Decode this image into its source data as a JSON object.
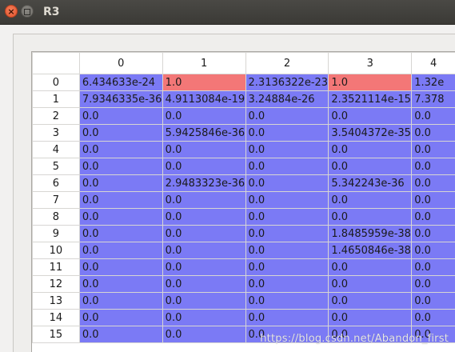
{
  "window": {
    "title": "R3"
  },
  "table": {
    "columns": [
      "0",
      "1",
      "2",
      "3",
      "4"
    ],
    "rows": [
      {
        "label": "0",
        "cells": [
          "6.434633e-24",
          "1.0",
          "2.3136322e-23",
          "1.0",
          "1.32e"
        ],
        "highlight": [
          false,
          true,
          false,
          true,
          false
        ]
      },
      {
        "label": "1",
        "cells": [
          "7.9346335e-36",
          "4.9113084e-19",
          "3.24884e-26",
          "2.3521114e-15",
          "7.378"
        ],
        "highlight": [
          false,
          false,
          false,
          false,
          false
        ]
      },
      {
        "label": "2",
        "cells": [
          "0.0",
          "0.0",
          "0.0",
          "0.0",
          "0.0"
        ],
        "highlight": [
          false,
          false,
          false,
          false,
          false
        ]
      },
      {
        "label": "3",
        "cells": [
          "0.0",
          "5.9425846e-36",
          "0.0",
          "3.5404372e-35",
          "0.0"
        ],
        "highlight": [
          false,
          false,
          false,
          false,
          false
        ]
      },
      {
        "label": "4",
        "cells": [
          "0.0",
          "0.0",
          "0.0",
          "0.0",
          "0.0"
        ],
        "highlight": [
          false,
          false,
          false,
          false,
          false
        ]
      },
      {
        "label": "5",
        "cells": [
          "0.0",
          "0.0",
          "0.0",
          "0.0",
          "0.0"
        ],
        "highlight": [
          false,
          false,
          false,
          false,
          false
        ]
      },
      {
        "label": "6",
        "cells": [
          "0.0",
          "2.9483323e-36",
          "0.0",
          "5.342243e-36",
          "0.0"
        ],
        "highlight": [
          false,
          false,
          false,
          false,
          false
        ]
      },
      {
        "label": "7",
        "cells": [
          "0.0",
          "0.0",
          "0.0",
          "0.0",
          "0.0"
        ],
        "highlight": [
          false,
          false,
          false,
          false,
          false
        ]
      },
      {
        "label": "8",
        "cells": [
          "0.0",
          "0.0",
          "0.0",
          "0.0",
          "0.0"
        ],
        "highlight": [
          false,
          false,
          false,
          false,
          false
        ]
      },
      {
        "label": "9",
        "cells": [
          "0.0",
          "0.0",
          "0.0",
          "1.8485959e-38",
          "0.0"
        ],
        "highlight": [
          false,
          false,
          false,
          false,
          false
        ]
      },
      {
        "label": "10",
        "cells": [
          "0.0",
          "0.0",
          "0.0",
          "1.4650846e-38",
          "0.0"
        ],
        "highlight": [
          false,
          false,
          false,
          false,
          false
        ]
      },
      {
        "label": "11",
        "cells": [
          "0.0",
          "0.0",
          "0.0",
          "0.0",
          "0.0"
        ],
        "highlight": [
          false,
          false,
          false,
          false,
          false
        ]
      },
      {
        "label": "12",
        "cells": [
          "0.0",
          "0.0",
          "0.0",
          "0.0",
          "0.0"
        ],
        "highlight": [
          false,
          false,
          false,
          false,
          false
        ]
      },
      {
        "label": "13",
        "cells": [
          "0.0",
          "0.0",
          "0.0",
          "0.0",
          "0.0"
        ],
        "highlight": [
          false,
          false,
          false,
          false,
          false
        ]
      },
      {
        "label": "14",
        "cells": [
          "0.0",
          "0.0",
          "0.0",
          "0.0",
          "0.0"
        ],
        "highlight": [
          false,
          false,
          false,
          false,
          false
        ]
      },
      {
        "label": "15",
        "cells": [
          "0.0",
          "0.0",
          "0.0",
          "0.0",
          "0.0"
        ],
        "highlight": [
          false,
          false,
          false,
          false,
          false
        ]
      }
    ]
  },
  "colors": {
    "cell": "#7b7af5",
    "highlight": "#f37777"
  },
  "watermark": "https://blog.csdn.net/Abandon_first"
}
